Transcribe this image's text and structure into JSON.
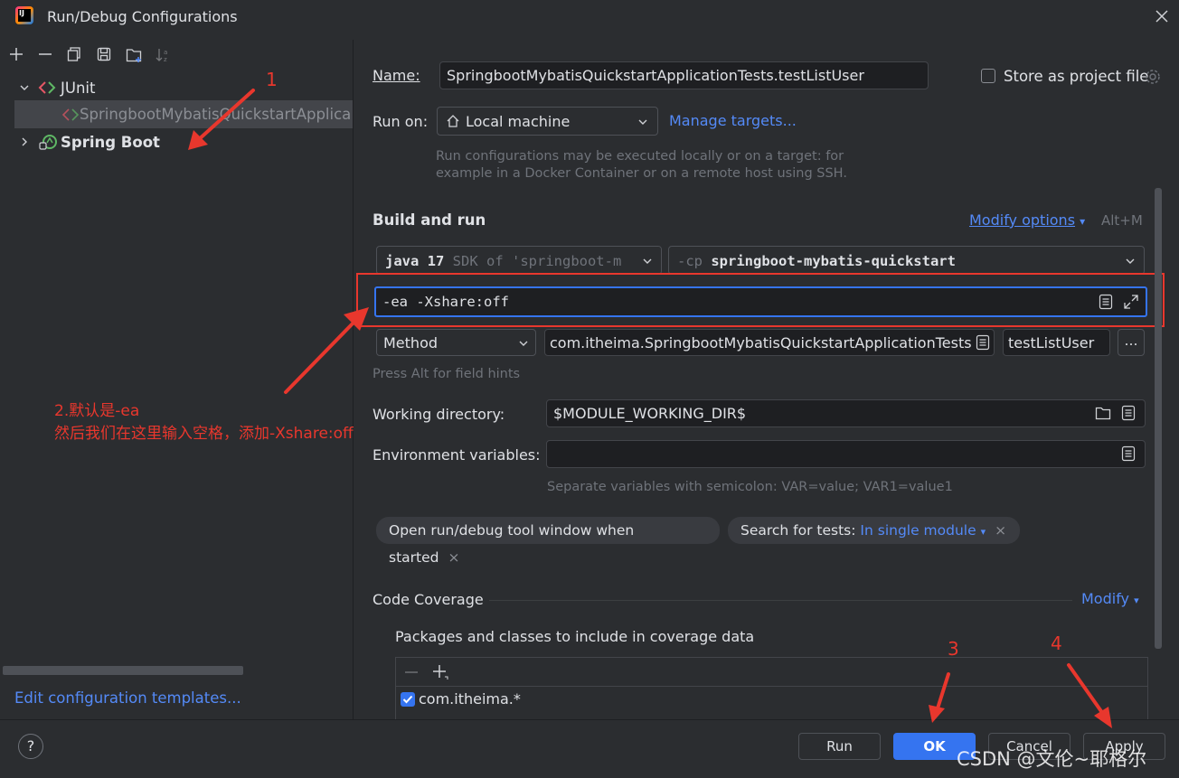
{
  "window": {
    "title": "Run/Debug Configurations"
  },
  "tree": {
    "junit_label": "JUnit",
    "junit_child": "SpringbootMybatisQuickstartApplicatio",
    "springboot_label": "Spring Boot",
    "edit_templates": "Edit configuration templates..."
  },
  "form": {
    "name_label": "Name:",
    "name_value": "SpringbootMybatisQuickstartApplicationTests.testListUser",
    "store_label": "Store as project file",
    "runon_label": "Run on:",
    "runon_value": "Local machine",
    "manage_targets": "Manage targets...",
    "runon_hint_1": "Run configurations may be executed locally or on a target: for",
    "runon_hint_2": "example in a Docker Container or on a remote host using SSH.",
    "build_run": "Build and run",
    "modify_options": "Modify options",
    "modify_shortcut": "Alt+M",
    "sdk_main": "java 17",
    "sdk_sub": "SDK of 'springboot-m",
    "cp_prefix": "-cp",
    "cp_value": "springboot-mybatis-quickstart",
    "vm_options": "-ea -Xshare:off",
    "test_kind": "Method",
    "test_class": "com.itheima.SpringbootMybatisQuickstartApplicationTests",
    "test_method": "testListUser",
    "field_hint": "Press Alt for field hints",
    "workdir_label": "Working directory:",
    "workdir_value": "$MODULE_WORKING_DIR$",
    "env_label": "Environment variables:",
    "env_hint": "Separate variables with semicolon: VAR=value; VAR1=value1",
    "chip_1": "Open run/debug tool window when started",
    "chip_2_prefix": "Search for tests:",
    "chip_2_value": "In single module",
    "coverage_title": "Code Coverage",
    "coverage_modify": "Modify",
    "coverage_packages": "Packages and classes to include in coverage data",
    "coverage_item": "com.itheima.*"
  },
  "buttons": {
    "run": "Run",
    "ok": "OK",
    "cancel": "Cancel",
    "apply": "Apply",
    "help": "?"
  },
  "annotations": {
    "n1": "1",
    "n2_line1": "2.默认是-ea",
    "n2_line2": "然后我们在这里输入空格，添加-Xshare:off",
    "n3": "3",
    "n4": "4"
  },
  "watermark": "CSDN @文伦~耶格尔",
  "colors": {
    "accent": "#3574f0",
    "annotation": "#e8372d",
    "link": "#548af7",
    "bg": "#2b2d30"
  }
}
